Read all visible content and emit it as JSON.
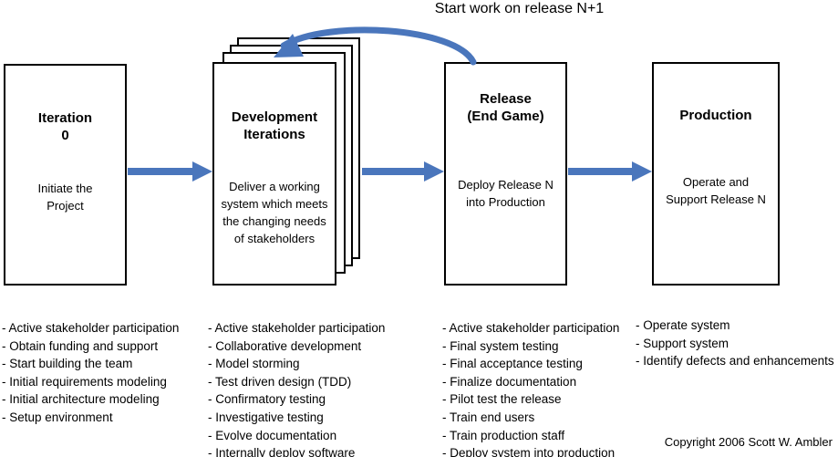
{
  "diagram": {
    "top_caption": "Start work on release N+1",
    "copyright": "Copyright 2006 Scott W. Ambler",
    "arrow_color": "#4A76BC",
    "box_border_color": "#000000",
    "background_color": "#FFFFFF"
  },
  "phases": [
    {
      "id": "iteration-0",
      "title": "Iteration\n0",
      "description": "Initiate the\nProject",
      "stacked": false,
      "activities": [
        "- Active stakeholder participation",
        "- Obtain funding and support",
        "- Start building the team",
        "- Initial requirements modeling",
        "- Initial architecture modeling",
        "- Setup environment"
      ]
    },
    {
      "id": "development-iterations",
      "title": "Development\nIterations",
      "description": "Deliver a working\nsystem which meets\nthe changing needs\nof stakeholders",
      "stacked": true,
      "activities": [
        "- Active stakeholder participation",
        "- Collaborative development",
        "- Model storming",
        "- Test driven design (TDD)",
        "- Confirmatory testing",
        "- Investigative testing",
        "- Evolve documentation",
        "- Internally deploy software"
      ]
    },
    {
      "id": "release-end-game",
      "title": "Release\n(End Game)",
      "description": "Deploy Release N\ninto Production",
      "stacked": false,
      "activities": [
        "- Active stakeholder participation",
        "- Final system testing",
        "- Final acceptance testing",
        "- Finalize documentation",
        "- Pilot test the release",
        "- Train end users",
        "- Train production staff",
        "- Deploy system into production"
      ]
    },
    {
      "id": "production",
      "title": "Production",
      "description": "Operate and\nSupport Release N",
      "stacked": false,
      "activities": [
        "- Operate system",
        "- Support system",
        "- Identify defects and enhancements"
      ]
    }
  ],
  "connectors": [
    {
      "id": "arrow-iteration0-to-development",
      "kind": "straight-arrow",
      "from": "iteration-0",
      "to": "development-iterations"
    },
    {
      "id": "arrow-development-to-release",
      "kind": "straight-arrow",
      "from": "development-iterations",
      "to": "release-end-game"
    },
    {
      "id": "arrow-release-to-production",
      "kind": "straight-arrow",
      "from": "release-end-game",
      "to": "production"
    },
    {
      "id": "arrow-release-back-to-development",
      "kind": "curved-arrow",
      "from": "release-end-game",
      "to": "development-iterations",
      "label": "Start work on release N+1"
    }
  ]
}
